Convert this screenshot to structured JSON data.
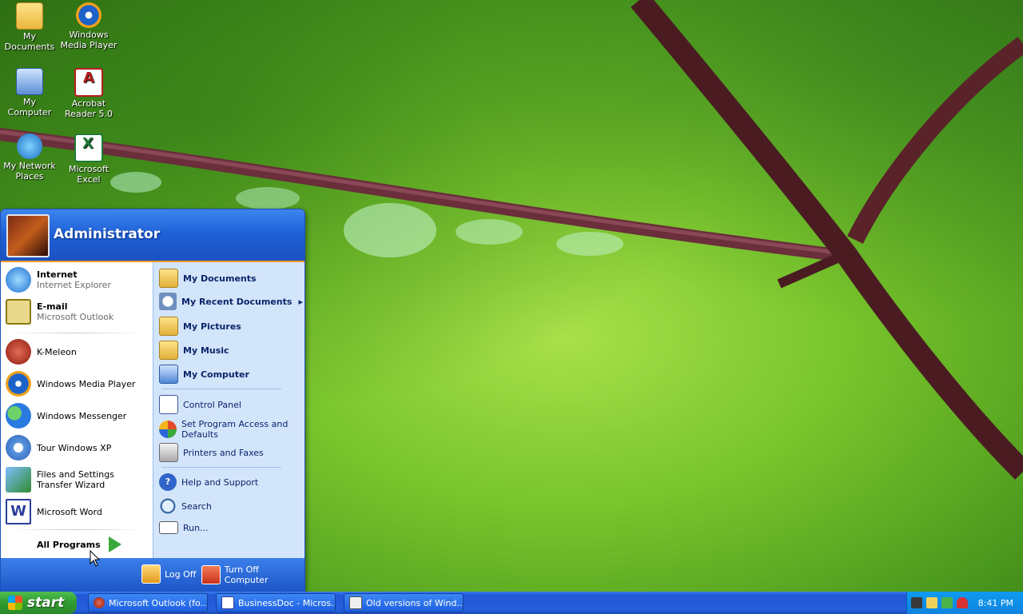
{
  "desktop": {
    "icons": [
      {
        "label": "My Documents",
        "icon": "my-documents-icon"
      },
      {
        "label": "Windows Media Player",
        "icon": "windows-media-player-icon"
      },
      {
        "label": "My Computer",
        "icon": "my-computer-icon"
      },
      {
        "label": "Acrobat Reader 5.0",
        "icon": "acrobat-reader-icon"
      },
      {
        "label": "My Network Places",
        "icon": "network-places-icon"
      },
      {
        "label": "Microsoft Excel",
        "icon": "excel-icon"
      }
    ]
  },
  "start_menu": {
    "user_name": "Administrator",
    "left_pinned": [
      {
        "title": "Internet",
        "subtitle": "Internet Explorer",
        "icon": "internet-explorer-icon"
      },
      {
        "title": "E-mail",
        "subtitle": "Microsoft Outlook",
        "icon": "outlook-icon"
      }
    ],
    "left_recent": [
      {
        "label": "K-Meleon",
        "icon": "k-meleon-icon"
      },
      {
        "label": "Windows Media Player",
        "icon": "windows-media-player-icon"
      },
      {
        "label": "Windows Messenger",
        "icon": "windows-messenger-icon"
      },
      {
        "label": "Tour Windows XP",
        "icon": "tour-windows-icon"
      },
      {
        "label": "Files and Settings Transfer Wizard",
        "icon": "transfer-wizard-icon"
      },
      {
        "label": "Microsoft Word",
        "icon": "word-icon"
      }
    ],
    "all_programs": "All Programs",
    "right_places": [
      {
        "label": "My Documents",
        "icon": "folder-icon"
      },
      {
        "label": "My Recent Documents",
        "icon": "recent-documents-icon",
        "arrow": "▸"
      },
      {
        "label": "My Pictures",
        "icon": "folder-icon"
      },
      {
        "label": "My Music",
        "icon": "folder-icon"
      },
      {
        "label": "My Computer",
        "icon": "computer-icon"
      }
    ],
    "right_settings": [
      {
        "label": "Control Panel",
        "icon": "control-panel-icon"
      },
      {
        "label": "Set Program Access and Defaults",
        "icon": "program-access-icon"
      },
      {
        "label": "Printers and Faxes",
        "icon": "printer-icon"
      }
    ],
    "right_help": [
      {
        "label": "Help and Support",
        "icon": "help-icon"
      },
      {
        "label": "Search",
        "icon": "search-icon"
      },
      {
        "label": "Run...",
        "icon": "run-icon"
      }
    ],
    "log_off": "Log Off",
    "turn_off": "Turn Off Computer"
  },
  "taskbar": {
    "start_label": "start",
    "tasks": [
      {
        "label": "Microsoft Outlook (fo...",
        "icon": "outlook-icon"
      },
      {
        "label": "BusinessDoc - Micros...",
        "icon": "word-icon"
      },
      {
        "label": "Old versions of Wind...",
        "icon": "document-icon"
      }
    ],
    "clock": "8:41 PM"
  },
  "colors": {
    "start_menu_header": "#1d5fd6",
    "start_button": "#2f9b2f",
    "taskbar": "#245dda",
    "tray": "#0e84e0"
  }
}
